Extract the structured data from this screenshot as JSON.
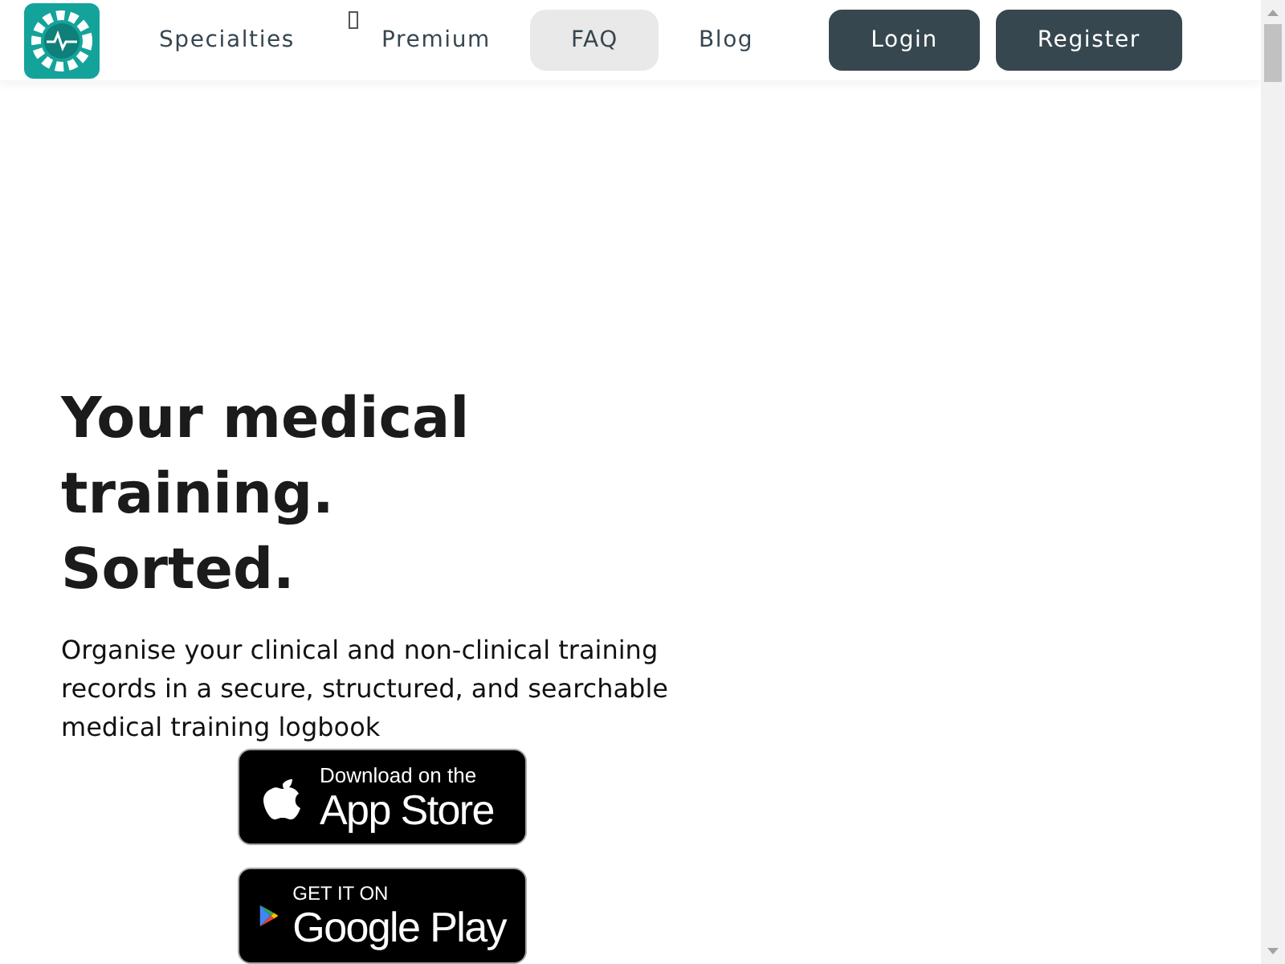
{
  "nav": {
    "items": [
      {
        "label": "Specialties",
        "selected": false,
        "has_dropdown": true
      },
      {
        "label": "Premium",
        "selected": false,
        "has_dropdown": false
      },
      {
        "label": "FAQ",
        "selected": true,
        "has_dropdown": false
      },
      {
        "label": "Blog",
        "selected": false,
        "has_dropdown": false
      }
    ],
    "buttons": [
      "Login",
      "Register"
    ]
  },
  "hero": {
    "heading": [
      "Your medical",
      "training.",
      "Sorted."
    ],
    "text": "Organise your clinical and non-clinical training records in a secure, structured, and searchable medical training logbook",
    "badges": [
      {
        "kind": "apple",
        "small": "Download on the",
        "big": "App Store"
      },
      {
        "kind": "google",
        "small": "GET IT ON",
        "big": "Google Play"
      }
    ]
  }
}
